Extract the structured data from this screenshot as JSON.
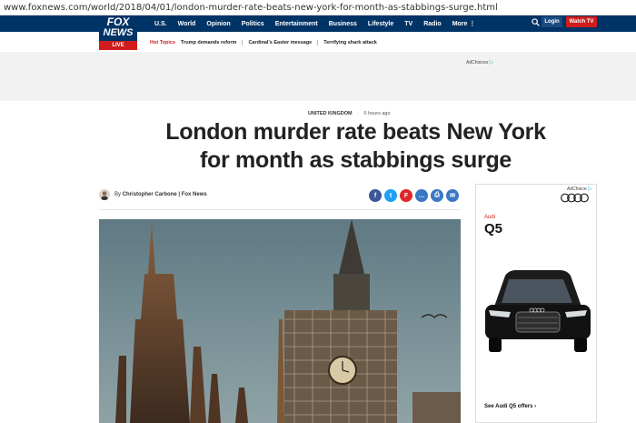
{
  "browser": {
    "url": "www.foxnews.com/world/2018/04/01/london-murder-rate-beats-new-york-for-month-as-stabbings-surge.html"
  },
  "logo": {
    "line1": "FOX",
    "line2": "NEWS",
    "line3": "LIVE"
  },
  "nav": {
    "items": [
      "U.S.",
      "World",
      "Opinion",
      "Politics",
      "Entertainment",
      "Business",
      "Lifestyle",
      "TV",
      "Radio",
      "More ⋮"
    ],
    "login": "Login",
    "watch": "Watch TV"
  },
  "topics": {
    "label": "Hot Topics",
    "items": [
      "Trump demands reform",
      "Cardinal's Easter message",
      "Terrifying shark attack"
    ]
  },
  "ads": {
    "adchoices": "AdChoices",
    "adchoices_short": "AdChoice",
    "triangle": "▷"
  },
  "article": {
    "section": "UNITED KINGDOM",
    "separator": "·",
    "time_ago": "6 hours ago",
    "headline_line1": "London murder rate beats New York",
    "headline_line2": "for month as stabbings surge",
    "by": "By",
    "author": "Christopher Carbone | Fox News"
  },
  "share_icons": [
    {
      "name": "facebook-icon",
      "glyph": "f",
      "color": "#3b5998"
    },
    {
      "name": "twitter-icon",
      "glyph": "t",
      "color": "#1da1f2"
    },
    {
      "name": "flipboard-icon",
      "glyph": "F",
      "color": "#e12828"
    },
    {
      "name": "comment-icon",
      "glyph": "…",
      "color": "#3b78c4"
    },
    {
      "name": "print-icon",
      "glyph": "⎙",
      "color": "#3b78c4"
    },
    {
      "name": "email-icon",
      "glyph": "✉",
      "color": "#3b78c4"
    }
  ],
  "side_ad": {
    "brand": "Audi",
    "model": "Q5",
    "cta": "See Audi Q5 offers ›"
  }
}
